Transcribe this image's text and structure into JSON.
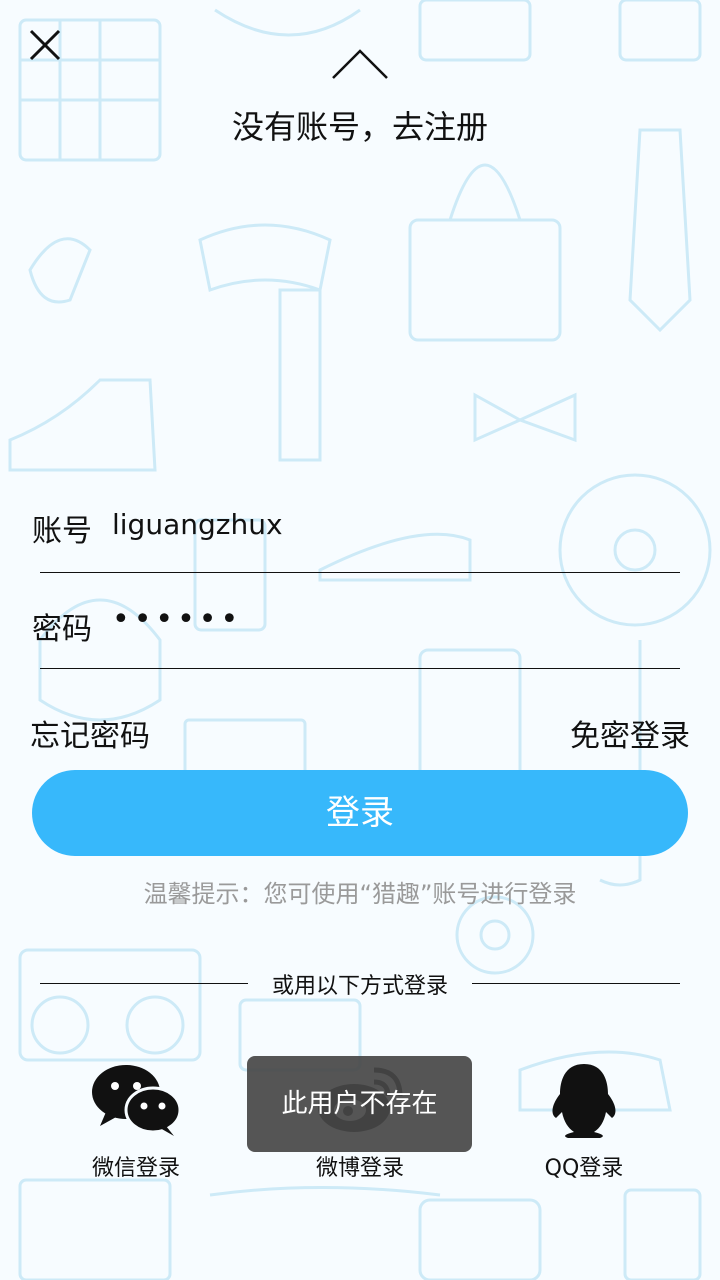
{
  "header": {
    "register_link": "没有账号，去注册"
  },
  "form": {
    "account_label": "账号",
    "account_value": "liguangzhux",
    "password_label": "密码",
    "password_mask": "••••••"
  },
  "links": {
    "forgot_password": "忘记密码",
    "passwordless_login": "免密登录"
  },
  "login_button": "登录",
  "tip": "温馨提示：您可使用“猎趣”账号进行登录",
  "alt_login": {
    "divider_text": "或用以下方式登录",
    "wechat": "微信登录",
    "weibo": "微博登录",
    "qq": "QQ登录"
  },
  "toast": "此用户不存在",
  "colors": {
    "accent": "#37b8fb",
    "background": "#f7fcff",
    "pattern": "#cdeaf7"
  }
}
